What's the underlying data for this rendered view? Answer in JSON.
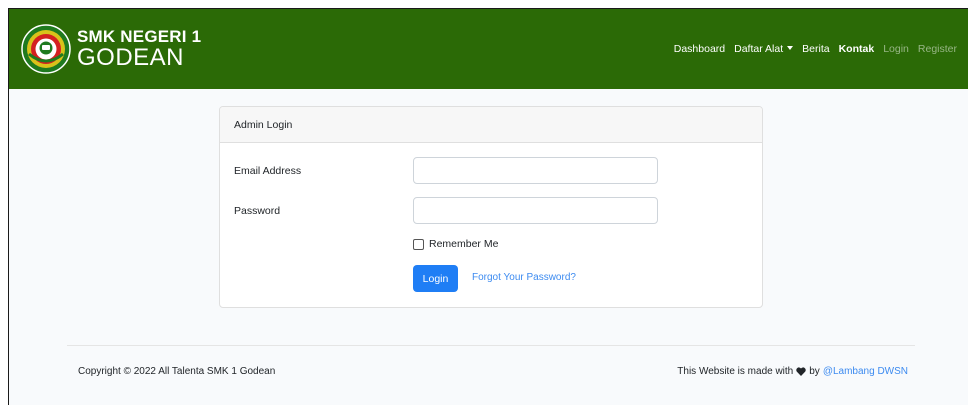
{
  "brand": {
    "line1": "SMK NEGERI 1",
    "line2": "GODEAN",
    "logo_icon": "school-emblem-icon"
  },
  "nav": {
    "items": [
      {
        "label": "Dashboard"
      },
      {
        "label": "Daftar Alat"
      },
      {
        "label": "Berita"
      },
      {
        "label": "Kontak"
      },
      {
        "label": "Login"
      },
      {
        "label": "Register"
      }
    ]
  },
  "login": {
    "header": "Admin Login",
    "email_label": "Email Address",
    "email_value": "",
    "password_label": "Password",
    "password_value": "",
    "remember_label": "Remember Me",
    "remember_checked": false,
    "submit_label": "Login",
    "forgot_label": "Forgot Your Password?"
  },
  "footer": {
    "copyright": "Copyright © 2022 All Talenta SMK 1 Godean",
    "credit_prefix": "This Website is made with",
    "credit_by": "by",
    "credit_link": "@Lambang DWSN"
  },
  "colors": {
    "navbar": "#2b6a06",
    "primary": "#1f7ef5",
    "link": "#3d8bf0"
  }
}
